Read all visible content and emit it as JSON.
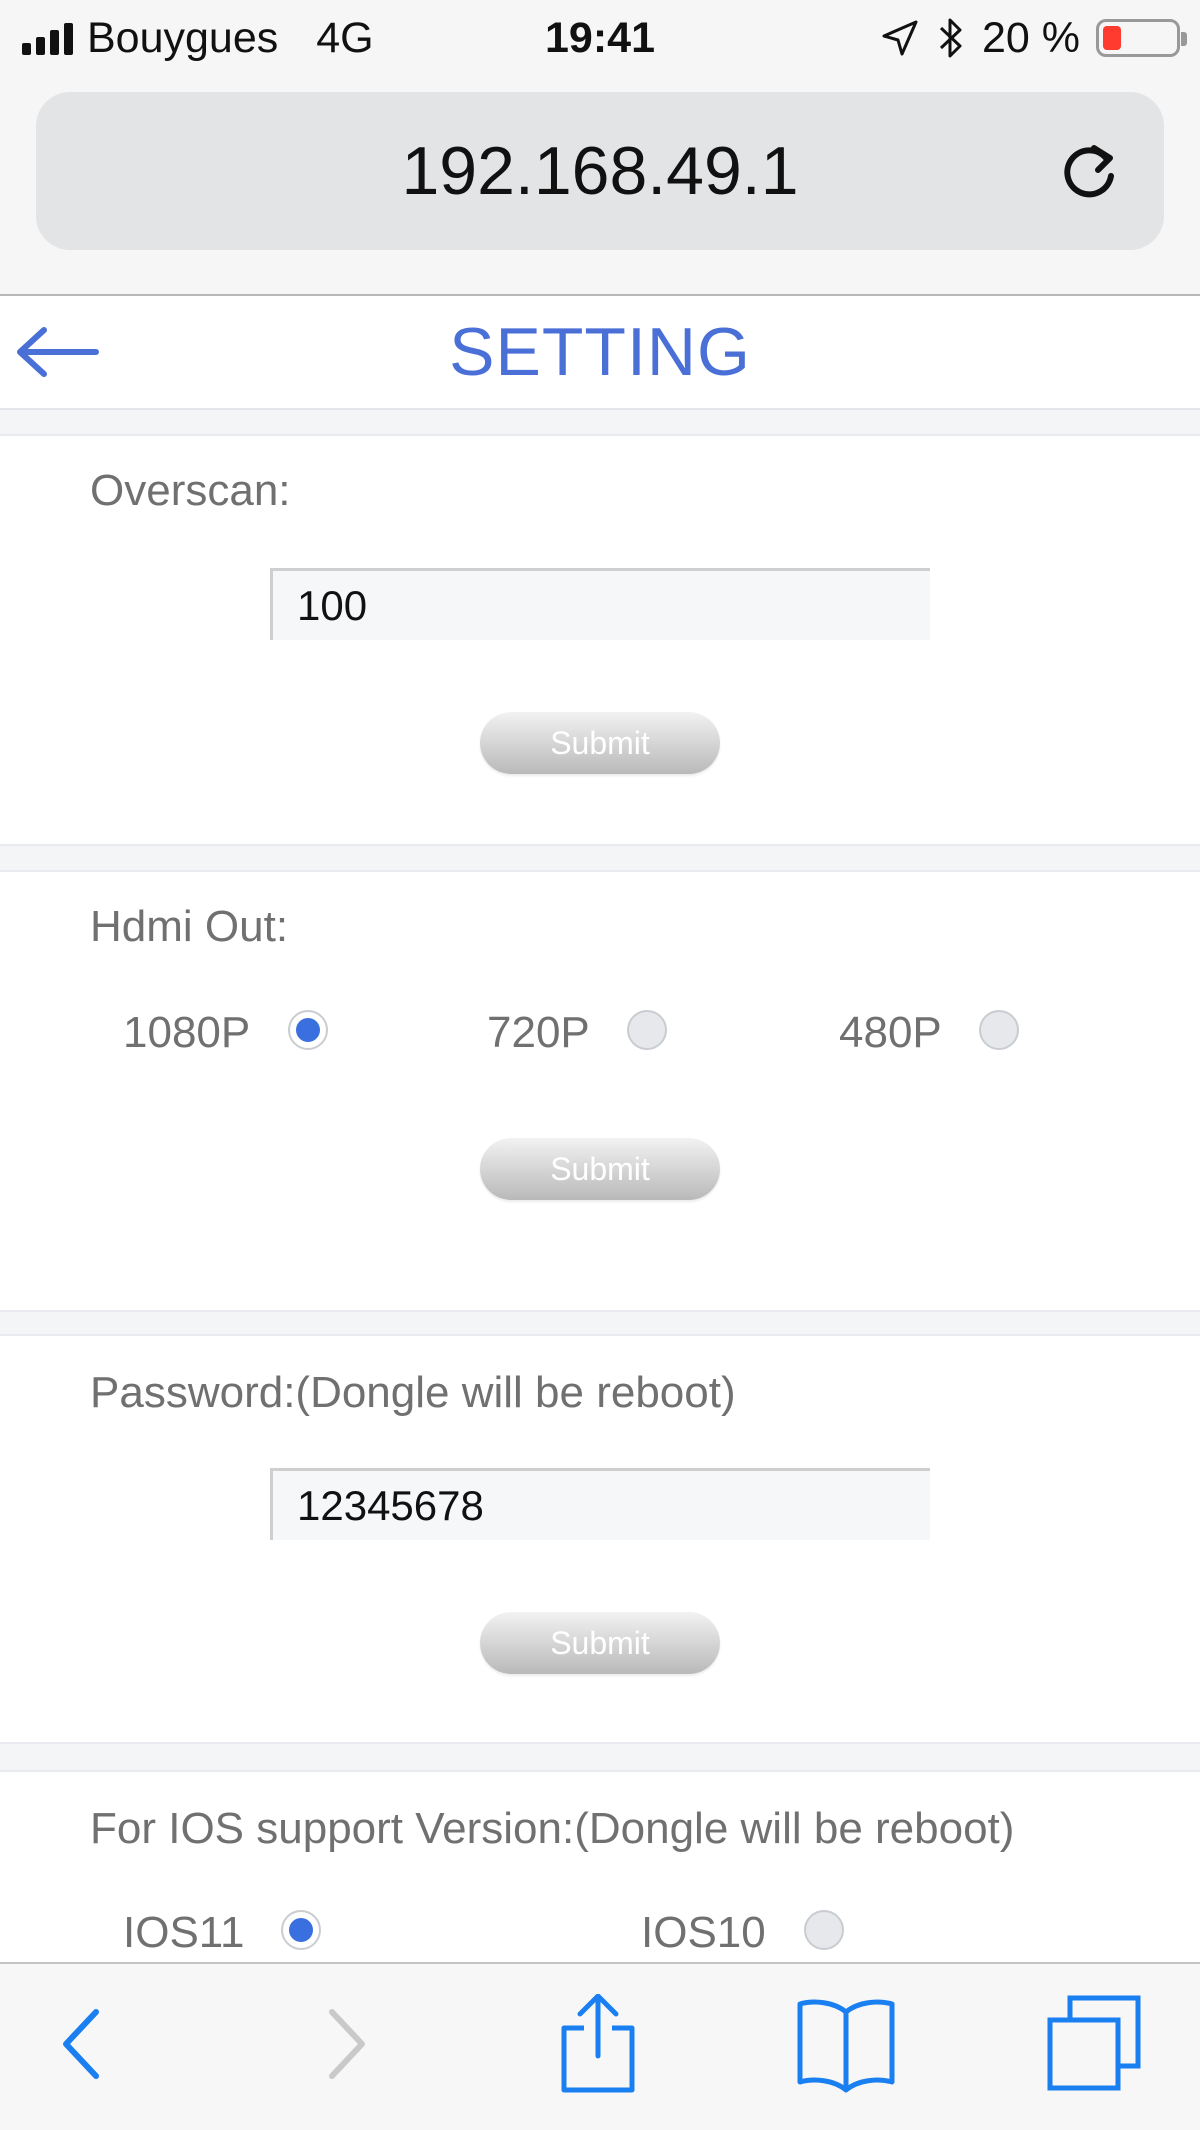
{
  "status_bar": {
    "carrier": "Bouygues",
    "network": "4G",
    "time": "19:41",
    "battery": "20 %",
    "battery_level": 0.2
  },
  "address_bar": {
    "url": "192.168.49.1"
  },
  "header": {
    "title": "SETTING"
  },
  "overscan": {
    "label": "Overscan:",
    "value": "100",
    "submit_label": "Submit"
  },
  "hdmi_out": {
    "label": "Hdmi Out:",
    "options": [
      {
        "label": "1080P",
        "checked": true
      },
      {
        "label": "720P",
        "checked": false
      },
      {
        "label": "480P",
        "checked": false
      }
    ],
    "submit_label": "Submit"
  },
  "password": {
    "label": "Password:(Dongle will be reboot)",
    "value": "12345678",
    "submit_label": "Submit"
  },
  "ios_support": {
    "label": "For IOS support Version:(Dongle will be reboot)",
    "options": [
      {
        "label": "IOS11",
        "checked": true
      },
      {
        "label": "IOS10",
        "checked": false
      }
    ]
  },
  "colors": {
    "accent": "#4a70d8",
    "ios_blue": "#1a7ff0",
    "radio_checked": "#3a6fe0",
    "battery_low": "#ff3b30"
  }
}
